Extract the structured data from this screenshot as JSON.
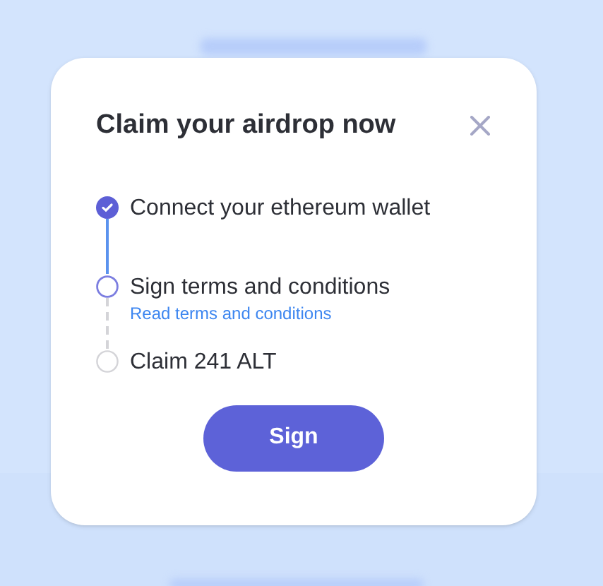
{
  "dialog": {
    "title": "Claim your airdrop now",
    "steps": [
      {
        "label": "Connect your ethereum wallet",
        "done": true,
        "selected": false
      },
      {
        "label": "Sign terms and conditions",
        "done": false,
        "selected": true,
        "link": "Read terms and conditions"
      },
      {
        "label": "Claim 241 ALT",
        "done": false,
        "selected": false
      }
    ],
    "button": "Sign"
  }
}
